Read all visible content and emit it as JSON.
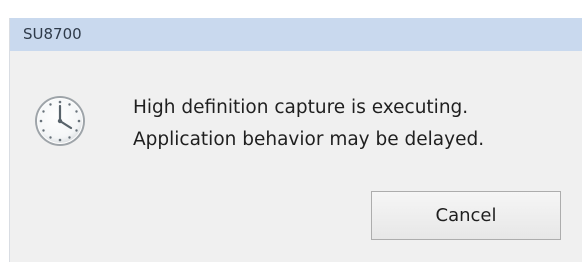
{
  "dialog": {
    "title": "SU8700",
    "icon": "clock-icon",
    "message_line_1": "High definition capture is executing.",
    "message_line_2": "Application behavior may be delayed.",
    "cancel_label": "Cancel"
  },
  "colors": {
    "titlebar": "#c9d9ee",
    "dialog_background": "#f0f0f0",
    "button_border": "#adadad",
    "text": "#1f1f1f"
  }
}
